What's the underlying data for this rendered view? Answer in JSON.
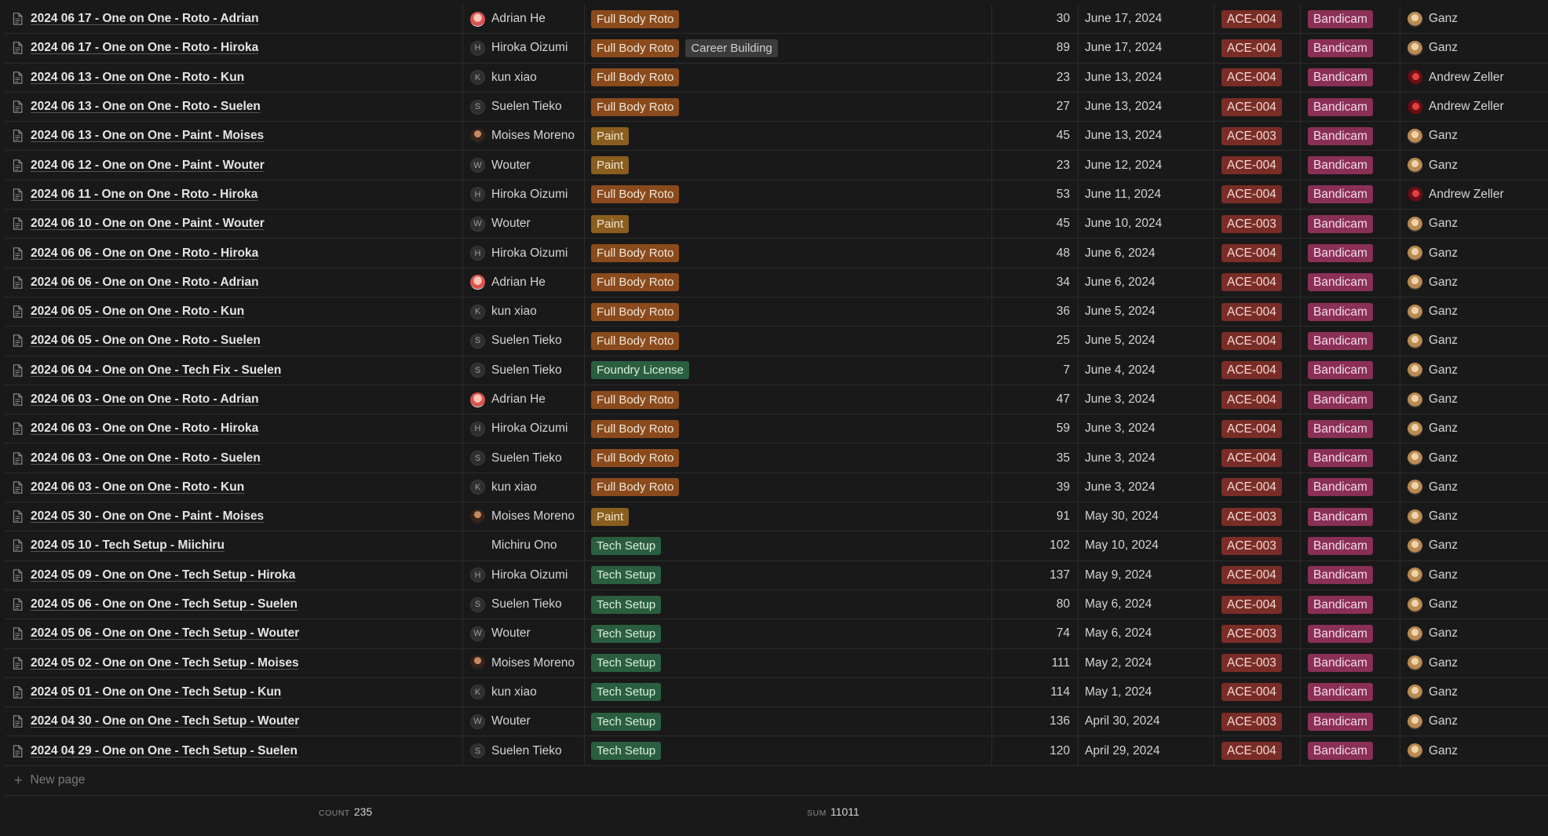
{
  "rows": [
    {
      "name": "2024 06 17 - One on One - Roto - Adrian",
      "person": "Adrian He",
      "avatar": "photo-red",
      "tags": [
        "Full Body Roto"
      ],
      "minutes": "30",
      "date": "June 17, 2024",
      "ace": "ACE-004",
      "capture": "Bandicam",
      "owner": "Ganz",
      "owner_avatar": "ganz"
    },
    {
      "name": "2024 06 17 - One on One - Roto - Hiroka",
      "person": "Hiroka Oizumi",
      "avatar": "H",
      "tags": [
        "Full Body Roto",
        "Career Building"
      ],
      "minutes": "89",
      "date": "June 17, 2024",
      "ace": "ACE-004",
      "capture": "Bandicam",
      "owner": "Ganz",
      "owner_avatar": "ganz"
    },
    {
      "name": "2024 06 13 - One on One - Roto - Kun",
      "person": "kun xiao",
      "avatar": "K",
      "tags": [
        "Full Body Roto"
      ],
      "minutes": "23",
      "date": "June 13, 2024",
      "ace": "ACE-004",
      "capture": "Bandicam",
      "owner": "Andrew Zeller",
      "owner_avatar": "andrew"
    },
    {
      "name": "2024 06 13 - One on One - Roto - Suelen",
      "person": "Suelen Tieko",
      "avatar": "S",
      "tags": [
        "Full Body Roto"
      ],
      "minutes": "27",
      "date": "June 13, 2024",
      "ace": "ACE-004",
      "capture": "Bandicam",
      "owner": "Andrew Zeller",
      "owner_avatar": "andrew"
    },
    {
      "name": "2024 06 13 - One on One - Paint - Moises",
      "person": "Moises Moreno",
      "avatar": "photo-dark",
      "tags": [
        "Paint"
      ],
      "minutes": "45",
      "date": "June 13, 2024",
      "ace": "ACE-003",
      "capture": "Bandicam",
      "owner": "Ganz",
      "owner_avatar": "ganz"
    },
    {
      "name": "2024 06 12 - One on One - Paint - Wouter",
      "person": "Wouter",
      "avatar": "W",
      "tags": [
        "Paint"
      ],
      "minutes": "23",
      "date": "June 12, 2024",
      "ace": "ACE-004",
      "capture": "Bandicam",
      "owner": "Ganz",
      "owner_avatar": "ganz"
    },
    {
      "name": "2024 06 11 - One on One - Roto - Hiroka",
      "person": "Hiroka Oizumi",
      "avatar": "H",
      "tags": [
        "Full Body Roto"
      ],
      "minutes": "53",
      "date": "June 11, 2024",
      "ace": "ACE-004",
      "capture": "Bandicam",
      "owner": "Andrew Zeller",
      "owner_avatar": "andrew"
    },
    {
      "name": "2024 06 10 - One on One - Paint - Wouter",
      "person": "Wouter",
      "avatar": "W",
      "tags": [
        "Paint"
      ],
      "minutes": "45",
      "date": "June 10, 2024",
      "ace": "ACE-003",
      "capture": "Bandicam",
      "owner": "Ganz",
      "owner_avatar": "ganz"
    },
    {
      "name": "2024 06 06 - One on  One - Roto - Hiroka",
      "person": "Hiroka Oizumi",
      "avatar": "H",
      "tags": [
        "Full Body Roto"
      ],
      "minutes": "48",
      "date": "June 6, 2024",
      "ace": "ACE-004",
      "capture": "Bandicam",
      "owner": "Ganz",
      "owner_avatar": "ganz"
    },
    {
      "name": "2024 06 06 - One on One - Roto - Adrian",
      "person": "Adrian He",
      "avatar": "photo-red",
      "tags": [
        "Full Body Roto"
      ],
      "minutes": "34",
      "date": "June 6, 2024",
      "ace": "ACE-004",
      "capture": "Bandicam",
      "owner": "Ganz",
      "owner_avatar": "ganz"
    },
    {
      "name": "2024 06 05 - One on One - Roto - Kun",
      "person": "kun xiao",
      "avatar": "K",
      "tags": [
        "Full Body Roto"
      ],
      "minutes": "36",
      "date": "June 5, 2024",
      "ace": "ACE-004",
      "capture": "Bandicam",
      "owner": "Ganz",
      "owner_avatar": "ganz"
    },
    {
      "name": "2024 06 05 - One on One - Roto - Suelen",
      "person": "Suelen Tieko",
      "avatar": "S",
      "tags": [
        "Full Body Roto"
      ],
      "minutes": "25",
      "date": "June 5, 2024",
      "ace": "ACE-004",
      "capture": "Bandicam",
      "owner": "Ganz",
      "owner_avatar": "ganz"
    },
    {
      "name": "2024 06 04 - One on One - Tech Fix - Suelen",
      "person": "Suelen Tieko",
      "avatar": "S",
      "tags": [
        "Foundry License"
      ],
      "minutes": "7",
      "date": "June 4, 2024",
      "ace": "ACE-004",
      "capture": "Bandicam",
      "owner": "Ganz",
      "owner_avatar": "ganz"
    },
    {
      "name": "2024 06 03 - One on One - Roto - Adrian",
      "person": "Adrian He",
      "avatar": "photo-red",
      "tags": [
        "Full Body Roto"
      ],
      "minutes": "47",
      "date": "June 3, 2024",
      "ace": "ACE-004",
      "capture": "Bandicam",
      "owner": "Ganz",
      "owner_avatar": "ganz"
    },
    {
      "name": "2024 06 03 - One on One - Roto - Hiroka",
      "person": "Hiroka Oizumi",
      "avatar": "H",
      "tags": [
        "Full Body Roto"
      ],
      "minutes": "59",
      "date": "June 3, 2024",
      "ace": "ACE-004",
      "capture": "Bandicam",
      "owner": "Ganz",
      "owner_avatar": "ganz"
    },
    {
      "name": "2024 06 03 - One on One - Roto - Suelen",
      "person": "Suelen Tieko",
      "avatar": "S",
      "tags": [
        "Full Body Roto"
      ],
      "minutes": "35",
      "date": "June 3, 2024",
      "ace": "ACE-004",
      "capture": "Bandicam",
      "owner": "Ganz",
      "owner_avatar": "ganz"
    },
    {
      "name": "2024 06 03 - One on One - Roto - Kun",
      "person": "kun xiao",
      "avatar": "K",
      "tags": [
        "Full Body Roto"
      ],
      "minutes": "39",
      "date": "June 3, 2024",
      "ace": "ACE-004",
      "capture": "Bandicam",
      "owner": "Ganz",
      "owner_avatar": "ganz"
    },
    {
      "name": "2024 05 30 - One on One - Paint - Moises",
      "person": "Moises Moreno",
      "avatar": "photo-dark",
      "tags": [
        "Paint"
      ],
      "minutes": "91",
      "date": "May 30, 2024",
      "ace": "ACE-003",
      "capture": "Bandicam",
      "owner": "Ganz",
      "owner_avatar": "ganz"
    },
    {
      "name": "2024 05 10 - Tech Setup - Miichiru",
      "person": "Michiru Ono",
      "avatar": "blank",
      "tags": [
        "Tech Setup"
      ],
      "minutes": "102",
      "date": "May 10, 2024",
      "ace": "ACE-003",
      "capture": "Bandicam",
      "owner": "Ganz",
      "owner_avatar": "ganz"
    },
    {
      "name": "2024 05 09 - One on One - Tech Setup - Hiroka",
      "person": "Hiroka Oizumi",
      "avatar": "H",
      "tags": [
        "Tech Setup"
      ],
      "minutes": "137",
      "date": "May 9, 2024",
      "ace": "ACE-004",
      "capture": "Bandicam",
      "owner": "Ganz",
      "owner_avatar": "ganz"
    },
    {
      "name": "2024 05 06 - One on One - Tech Setup - Suelen",
      "person": "Suelen Tieko",
      "avatar": "S",
      "tags": [
        "Tech Setup"
      ],
      "minutes": "80",
      "date": "May 6, 2024",
      "ace": "ACE-004",
      "capture": "Bandicam",
      "owner": "Ganz",
      "owner_avatar": "ganz"
    },
    {
      "name": "2024 05 06 - One on One - Tech Setup - Wouter",
      "person": "Wouter",
      "avatar": "W",
      "tags": [
        "Tech Setup"
      ],
      "minutes": "74",
      "date": "May 6, 2024",
      "ace": "ACE-003",
      "capture": "Bandicam",
      "owner": "Ganz",
      "owner_avatar": "ganz"
    },
    {
      "name": "2024 05 02 - One on One - Tech Setup - Moises",
      "person": "Moises Moreno",
      "avatar": "photo-dark",
      "tags": [
        "Tech Setup"
      ],
      "minutes": "111",
      "date": "May 2, 2024",
      "ace": "ACE-003",
      "capture": "Bandicam",
      "owner": "Ganz",
      "owner_avatar": "ganz"
    },
    {
      "name": "2024 05 01 - One on One - Tech Setup - Kun",
      "person": "kun xiao",
      "avatar": "K",
      "tags": [
        "Tech Setup"
      ],
      "minutes": "114",
      "date": "May 1, 2024",
      "ace": "ACE-004",
      "capture": "Bandicam",
      "owner": "Ganz",
      "owner_avatar": "ganz"
    },
    {
      "name": "2024 04 30 - One on One - Tech Setup - Wouter",
      "person": "Wouter",
      "avatar": "W",
      "tags": [
        "Tech Setup"
      ],
      "minutes": "136",
      "date": "April 30, 2024",
      "ace": "ACE-003",
      "capture": "Bandicam",
      "owner": "Ganz",
      "owner_avatar": "ganz"
    },
    {
      "name": "2024 04 29 - One on One - Tech Setup - Suelen",
      "person": "Suelen Tieko",
      "avatar": "S",
      "tags": [
        "Tech Setup"
      ],
      "minutes": "120",
      "date": "April 29, 2024",
      "ace": "ACE-004",
      "capture": "Bandicam",
      "owner": "Ganz",
      "owner_avatar": "ganz"
    }
  ],
  "new_page_label": "New page",
  "footer": {
    "count_label": "COUNT",
    "count_value": "235",
    "sum_label": "SUM",
    "sum_value": "11011"
  },
  "tag_styles": {
    "Full Body Roto": "tag-roto",
    "Career Building": "tag-career",
    "Paint": "tag-paint",
    "Tech Setup": "tag-tech",
    "Foundry License": "tag-tech"
  },
  "icons": {
    "row": "page-icon",
    "add": "plus-icon"
  }
}
